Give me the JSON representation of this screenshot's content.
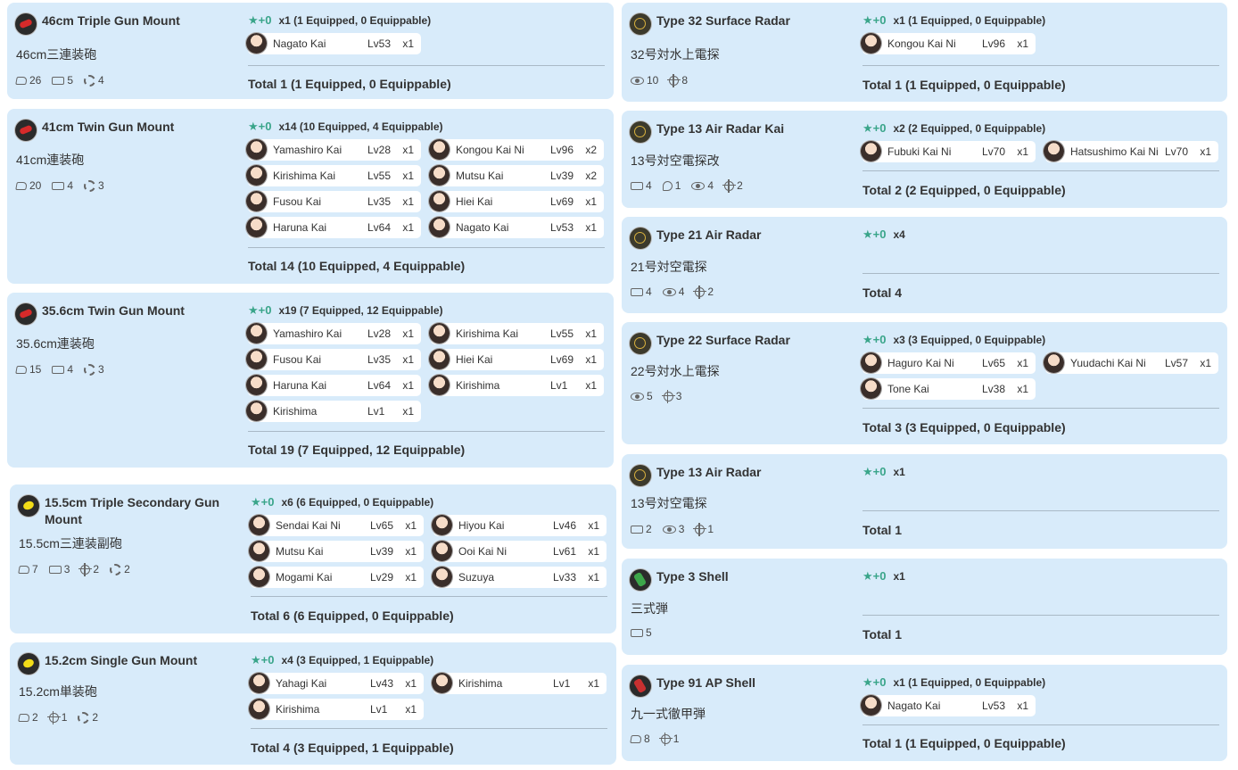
{
  "cards": [
    {
      "name": "46cm Triple Gun Mount",
      "jp": "46cm三連装砲",
      "icon": "red-gun-icon",
      "stats": [
        {
          "icon": "firepower-icon",
          "value": "26"
        },
        {
          "icon": "anti-air-icon",
          "value": "5"
        },
        {
          "icon": "range-icon",
          "value": "4"
        }
      ],
      "star": "★+0",
      "count": "x1 (1 Equipped, 0 Equippable)",
      "ships": [
        {
          "name": "Nagato Kai",
          "lv": "Lv53",
          "n": "x1"
        }
      ],
      "total": "Total 1 (1 Equipped, 0 Equippable)"
    },
    {
      "name": "41cm Twin Gun Mount",
      "jp": "41cm連装砲",
      "icon": "red-gun-icon",
      "stats": [
        {
          "icon": "firepower-icon",
          "value": "20"
        },
        {
          "icon": "anti-air-icon",
          "value": "4"
        },
        {
          "icon": "range-icon",
          "value": "3"
        }
      ],
      "star": "★+0",
      "count": "x14 (10 Equipped, 4 Equippable)",
      "ships": [
        {
          "name": "Yamashiro Kai",
          "lv": "Lv28",
          "n": "x1"
        },
        {
          "name": "Kongou Kai Ni",
          "lv": "Lv96",
          "n": "x2"
        },
        {
          "name": "Kirishima Kai",
          "lv": "Lv55",
          "n": "x1"
        },
        {
          "name": "Mutsu Kai",
          "lv": "Lv39",
          "n": "x2"
        },
        {
          "name": "Fusou Kai",
          "lv": "Lv35",
          "n": "x1"
        },
        {
          "name": "Hiei Kai",
          "lv": "Lv69",
          "n": "x1"
        },
        {
          "name": "Haruna Kai",
          "lv": "Lv64",
          "n": "x1"
        },
        {
          "name": "Nagato Kai",
          "lv": "Lv53",
          "n": "x1"
        }
      ],
      "total": "Total 14 (10 Equipped, 4 Equippable)"
    },
    {
      "name": "35.6cm Twin Gun Mount",
      "jp": "35.6cm連装砲",
      "icon": "red-gun-icon",
      "stats": [
        {
          "icon": "firepower-icon",
          "value": "15"
        },
        {
          "icon": "anti-air-icon",
          "value": "4"
        },
        {
          "icon": "range-icon",
          "value": "3"
        }
      ],
      "star": "★+0",
      "count": "x19 (7 Equipped, 12 Equippable)",
      "ships": [
        {
          "name": "Yamashiro Kai",
          "lv": "Lv28",
          "n": "x1"
        },
        {
          "name": "Kirishima Kai",
          "lv": "Lv55",
          "n": "x1"
        },
        {
          "name": "Fusou Kai",
          "lv": "Lv35",
          "n": "x1"
        },
        {
          "name": "Hiei Kai",
          "lv": "Lv69",
          "n": "x1"
        },
        {
          "name": "Haruna Kai",
          "lv": "Lv64",
          "n": "x1"
        },
        {
          "name": "Kirishima",
          "lv": "Lv1",
          "n": "x1"
        },
        {
          "name": "Kirishima",
          "lv": "Lv1",
          "n": "x1"
        }
      ],
      "total": "Total 19 (7 Equipped, 12 Equippable)"
    },
    {
      "name": "15.5cm Triple Secondary Gun Mount",
      "jp": "15.5cm三連装副砲",
      "icon": "yellow-gun-icon",
      "stats": [
        {
          "icon": "firepower-icon",
          "value": "7"
        },
        {
          "icon": "anti-air-icon",
          "value": "3"
        },
        {
          "icon": "accuracy-icon",
          "value": "2"
        },
        {
          "icon": "range-icon",
          "value": "2"
        }
      ],
      "star": "★+0",
      "count": "x6 (6 Equipped, 0 Equippable)",
      "ships": [
        {
          "name": "Sendai Kai Ni",
          "lv": "Lv65",
          "n": "x1"
        },
        {
          "name": "Hiyou Kai",
          "lv": "Lv46",
          "n": "x1"
        },
        {
          "name": "Mutsu Kai",
          "lv": "Lv39",
          "n": "x1"
        },
        {
          "name": "Ooi Kai Ni",
          "lv": "Lv61",
          "n": "x1"
        },
        {
          "name": "Mogami Kai",
          "lv": "Lv29",
          "n": "x1"
        },
        {
          "name": "Suzuya",
          "lv": "Lv33",
          "n": "x1"
        }
      ],
      "total": "Total 6 (6 Equipped, 0 Equippable)"
    },
    {
      "name": "15.2cm Single Gun Mount",
      "jp": "15.2cm単装砲",
      "icon": "yellow-gun-icon",
      "stats": [
        {
          "icon": "firepower-icon",
          "value": "2"
        },
        {
          "icon": "accuracy-icon",
          "value": "1"
        },
        {
          "icon": "range-icon",
          "value": "2"
        }
      ],
      "star": "★+0",
      "count": "x4 (3 Equipped, 1 Equippable)",
      "ships": [
        {
          "name": "Yahagi Kai",
          "lv": "Lv43",
          "n": "x1"
        },
        {
          "name": "Kirishima",
          "lv": "Lv1",
          "n": "x1"
        },
        {
          "name": "Kirishima",
          "lv": "Lv1",
          "n": "x1"
        }
      ],
      "total": "Total 4 (3 Equipped, 1 Equippable)"
    },
    {
      "name": "Type 32 Surface Radar",
      "jp": "32号対水上電探",
      "icon": "radar-icon",
      "stats": [
        {
          "icon": "line-of-sight-icon",
          "value": "10"
        },
        {
          "icon": "accuracy-icon",
          "value": "8"
        }
      ],
      "star": "★+0",
      "count": "x1 (1 Equipped, 0 Equippable)",
      "ships": [
        {
          "name": "Kongou Kai Ni",
          "lv": "Lv96",
          "n": "x1"
        }
      ],
      "total": "Total 1 (1 Equipped, 0 Equippable)"
    },
    {
      "name": "Type 13 Air Radar Kai",
      "jp": "13号対空電探改",
      "icon": "radar-icon",
      "stats": [
        {
          "icon": "anti-air-icon",
          "value": "4"
        },
        {
          "icon": "armor-icon",
          "value": "1"
        },
        {
          "icon": "line-of-sight-icon",
          "value": "4"
        },
        {
          "icon": "accuracy-icon",
          "value": "2"
        }
      ],
      "star": "★+0",
      "count": "x2 (2 Equipped, 0 Equippable)",
      "ships": [
        {
          "name": "Fubuki Kai Ni",
          "lv": "Lv70",
          "n": "x1"
        },
        {
          "name": "Hatsushimo Kai Ni",
          "lv": "Lv70",
          "n": "x1"
        }
      ],
      "total": "Total 2 (2 Equipped, 0 Equippable)"
    },
    {
      "name": "Type 21 Air Radar",
      "jp": "21号対空電探",
      "icon": "radar-icon",
      "stats": [
        {
          "icon": "anti-air-icon",
          "value": "4"
        },
        {
          "icon": "line-of-sight-icon",
          "value": "4"
        },
        {
          "icon": "accuracy-icon",
          "value": "2"
        }
      ],
      "star": "★+0",
      "count": "x4",
      "ships": [],
      "total": "Total 4"
    },
    {
      "name": "Type 22 Surface Radar",
      "jp": "22号対水上電探",
      "icon": "radar-icon",
      "stats": [
        {
          "icon": "line-of-sight-icon",
          "value": "5"
        },
        {
          "icon": "accuracy-icon",
          "value": "3"
        }
      ],
      "star": "★+0",
      "count": "x3 (3 Equipped, 0 Equippable)",
      "ships": [
        {
          "name": "Haguro Kai Ni",
          "lv": "Lv65",
          "n": "x1"
        },
        {
          "name": "Yuudachi Kai Ni",
          "lv": "Lv57",
          "n": "x1"
        },
        {
          "name": "Tone Kai",
          "lv": "Lv38",
          "n": "x1"
        }
      ],
      "total": "Total 3 (3 Equipped, 0 Equippable)"
    },
    {
      "name": "Type 13 Air Radar",
      "jp": "13号対空電探",
      "icon": "radar-icon",
      "stats": [
        {
          "icon": "anti-air-icon",
          "value": "2"
        },
        {
          "icon": "line-of-sight-icon",
          "value": "3"
        },
        {
          "icon": "accuracy-icon",
          "value": "1"
        }
      ],
      "star": "★+0",
      "count": "x1",
      "ships": [],
      "total": "Total 1"
    },
    {
      "name": "Type 3 Shell",
      "jp": "三式弾",
      "icon": "green-shell-icon",
      "stats": [
        {
          "icon": "anti-air-icon",
          "value": "5"
        }
      ],
      "star": "★+0",
      "count": "x1",
      "ships": [],
      "total": "Total 1"
    },
    {
      "name": "Type 91 AP Shell",
      "jp": "九一式徹甲弾",
      "icon": "red-shell-icon",
      "stats": [
        {
          "icon": "firepower-icon",
          "value": "8"
        },
        {
          "icon": "accuracy-icon",
          "value": "1"
        }
      ],
      "star": "★+0",
      "count": "x1 (1 Equipped, 0 Equippable)",
      "ships": [
        {
          "name": "Nagato Kai",
          "lv": "Lv53",
          "n": "x1"
        }
      ],
      "total": "Total 1 (1 Equipped, 0 Equippable)"
    }
  ]
}
